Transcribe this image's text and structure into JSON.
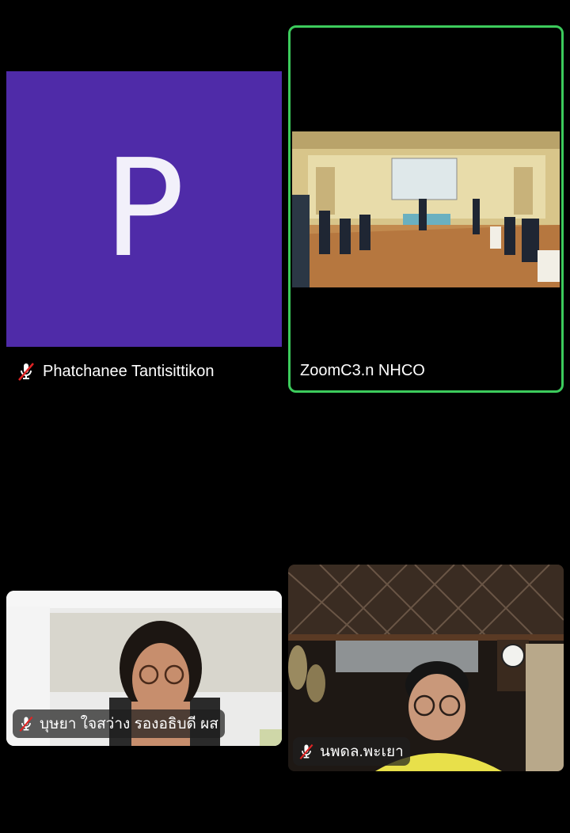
{
  "participants": [
    {
      "id": "p1",
      "initial": "P",
      "name": "Phatchanee Tantisittikon",
      "muted": true,
      "avatar_color": "#4f2ba8"
    },
    {
      "id": "p2",
      "name": "ZoomC3.n NHCO",
      "muted": false,
      "active_speaker": true,
      "highlight_color": "#3ccb5c"
    },
    {
      "id": "p3",
      "name": "บุษยา ใจสว่าง รองอธิบดี ผส",
      "muted": true
    },
    {
      "id": "p4",
      "name": "นพดล.พะเยา",
      "muted": true
    }
  ],
  "icons": {
    "muted": "mic-off-icon"
  }
}
